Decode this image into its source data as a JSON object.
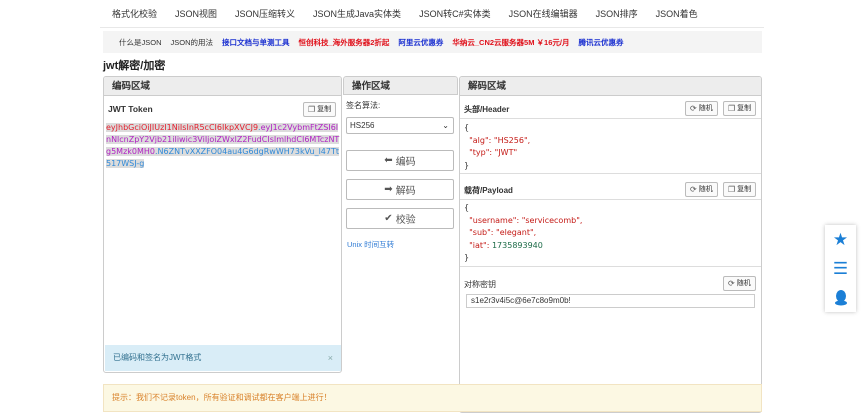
{
  "nav": [
    "格式化校验",
    "JSON视图",
    "JSON压缩转义",
    "JSON生成Java实体类",
    "JSON转C#实体类",
    "JSON在线编辑器",
    "JSON排序",
    "JSON着色"
  ],
  "links": [
    {
      "text": "什么是JSON",
      "style": "plain"
    },
    {
      "text": "JSON的用法",
      "style": "plain"
    },
    {
      "text": "接口文档与单测工具",
      "style": "blue"
    },
    {
      "text": "恒创科技_海外服务器2折起",
      "style": "red"
    },
    {
      "text": "阿里云优惠券",
      "style": "blue"
    },
    {
      "text": "华纳云_CN2云服务器5M ￥16元/月",
      "style": "red"
    },
    {
      "text": "腾讯云优惠券",
      "style": "blue"
    }
  ],
  "page_title": "jwt解密/加密",
  "encode_panel": {
    "title": "编码区域",
    "token_label": "JWT Token",
    "copy_label": "复制",
    "token_header": "eyJhbGciOiJIUzI1NiIsInR5cCI6IkpXVCJ9",
    "token_payload": "eyJ1c2VybmFtZSI6InNlcnZpY2Vjb21iIiwic3ViIjoiZWxlZ2FudCIsImlhdCI6MTczNTg5Mzk0MH0",
    "token_signature": "N6ZNTvXXZFO04au4G6dgRwWH73kVu_l47Tt517WSJ-g",
    "status": "已编码和签名为JWT格式",
    "close": "×"
  },
  "ops_panel": {
    "title": "操作区域",
    "algo_label": "签名算法:",
    "algo_value": "HS256",
    "encode_btn": "编码",
    "decode_btn": "解码",
    "verify_btn": "校验",
    "timestamp_link": "Unix 时间互转"
  },
  "decode_panel": {
    "title": "解码区域",
    "header_label": "头部/Header",
    "payload_label": "载荷/Payload",
    "secret_label": "对称密钥",
    "random_label": "随机",
    "copy_label": "复制",
    "header_json": {
      "open": "{",
      "alg_key": "\"alg\": ",
      "alg_val": "\"HS256\",",
      "typ_key": "\"typ\": ",
      "typ_val": "\"JWT\"",
      "close": "}"
    },
    "payload_json": {
      "open": "{",
      "username_key": "\"username\": ",
      "username_val": "\"servicecomb\",",
      "sub_key": "\"sub\": ",
      "sub_val": "\"elegant\",",
      "iat_key": "\"iat\": ",
      "iat_val": "1735893940",
      "close": "}"
    },
    "secret_value": "s1e2r3v4i5c@6e7c8o9m0b!"
  },
  "tip": "提示：我们不记录token，所有验证和调试都在客户端上进行！",
  "colors": {
    "accent": "#1b7fd6",
    "info_bg": "#d9edf7",
    "warn_bg": "#fcf8e3"
  },
  "side_icons": [
    "star-icon",
    "menu-icon",
    "qq-icon"
  ]
}
